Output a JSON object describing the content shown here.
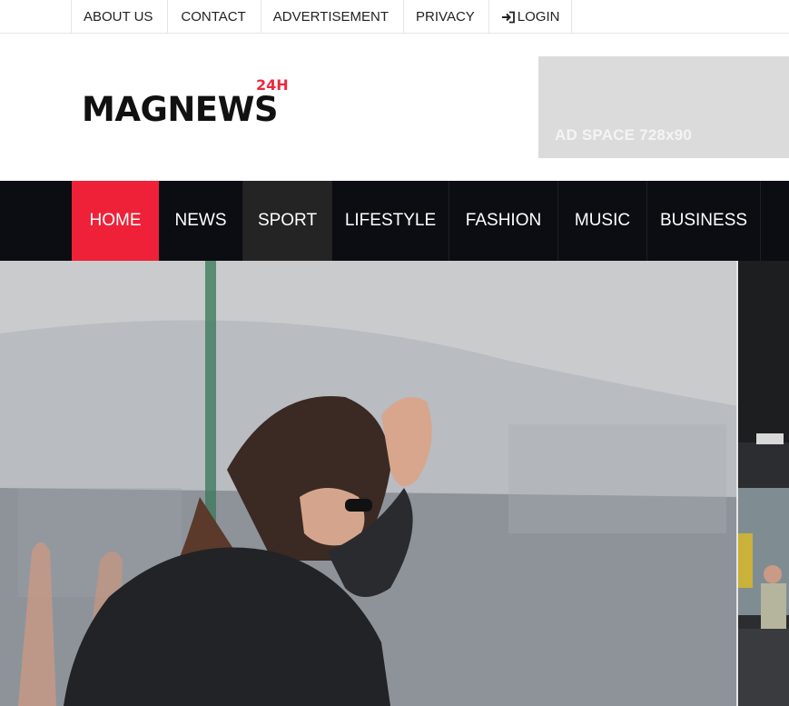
{
  "topbar": {
    "items": [
      {
        "label": "ABOUT US"
      },
      {
        "label": "CONTACT"
      },
      {
        "label": "ADVERTISEMENT"
      },
      {
        "label": "PRIVACY"
      },
      {
        "label": "LOGIN",
        "icon": "login-icon"
      }
    ]
  },
  "header": {
    "logo": {
      "main": "MAGNEWS",
      "badge": "24H"
    },
    "ad": {
      "text": "AD SPACE 728x90"
    }
  },
  "nav": {
    "items": [
      {
        "label": "HOME",
        "active": true
      },
      {
        "label": "NEWS"
      },
      {
        "label": "SPORT"
      },
      {
        "label": "LIFESTYLE"
      },
      {
        "label": "FASHION"
      },
      {
        "label": "MUSIC"
      },
      {
        "label": "BUSINESS"
      }
    ]
  },
  "colors": {
    "accent": "#ee2138",
    "nav_bg": "#0c0d12",
    "hover_bg": "#242424",
    "ad_bg": "#dbdbdb"
  }
}
